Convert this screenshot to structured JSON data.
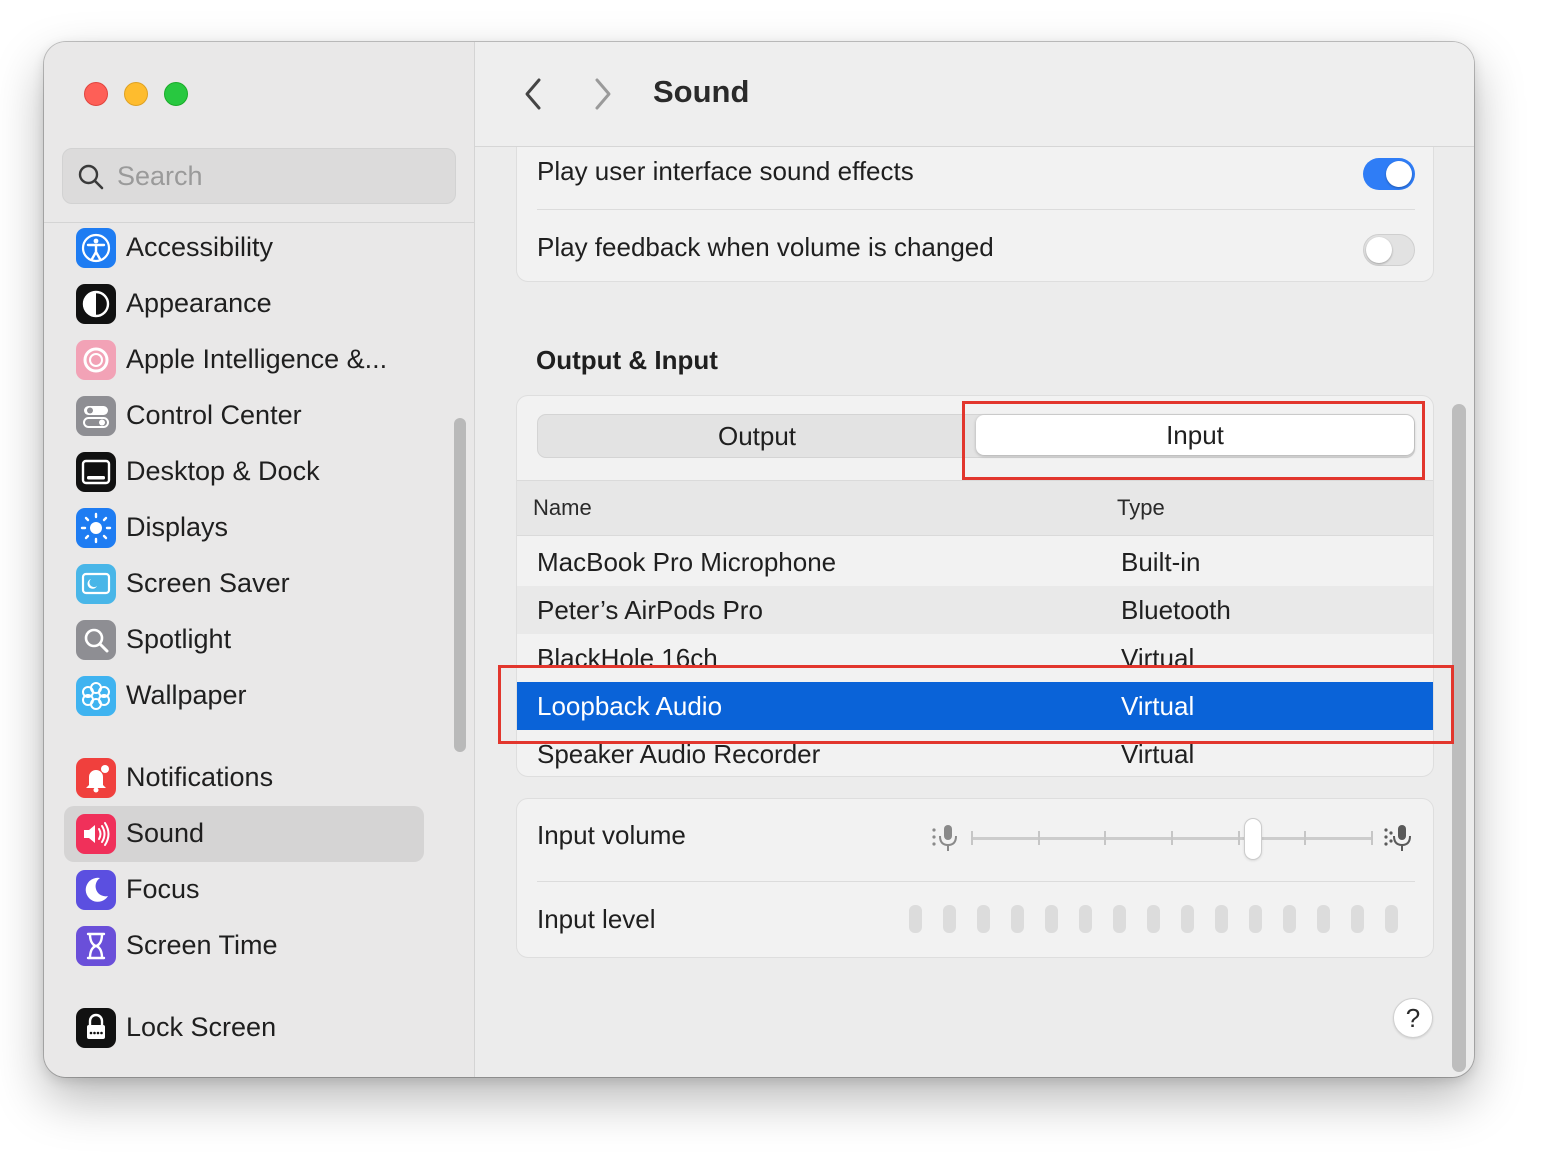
{
  "window": {
    "title": "Sound"
  },
  "sidebar": {
    "search_placeholder": "Search",
    "items": [
      {
        "label": "Accessibility",
        "icon": "accessibility-icon",
        "color": "#1e7cf2"
      },
      {
        "label": "Appearance",
        "icon": "appearance-icon",
        "color": "#111111"
      },
      {
        "label": "Apple Intelligence &...",
        "icon": "apple-intelligence-icon",
        "color": "#f2a2b6"
      },
      {
        "label": "Control Center",
        "icon": "control-center-icon",
        "color": "#8e8e93"
      },
      {
        "label": "Desktop & Dock",
        "icon": "desktop-dock-icon",
        "color": "#111111"
      },
      {
        "label": "Displays",
        "icon": "displays-icon",
        "color": "#1e7cf2"
      },
      {
        "label": "Screen Saver",
        "icon": "screen-saver-icon",
        "color": "#49b6e8"
      },
      {
        "label": "Spotlight",
        "icon": "spotlight-icon",
        "color": "#8e8e93"
      },
      {
        "label": "Wallpaper",
        "icon": "wallpaper-icon",
        "color": "#3fb3f0"
      },
      {
        "label": "Notifications",
        "icon": "notifications-icon",
        "color": "#f0403d"
      },
      {
        "label": "Sound",
        "icon": "sound-icon",
        "color": "#f0305a",
        "selected": true
      },
      {
        "label": "Focus",
        "icon": "focus-icon",
        "color": "#5b4fe0"
      },
      {
        "label": "Screen Time",
        "icon": "screen-time-icon",
        "color": "#6a4fd9"
      },
      {
        "label": "Lock Screen",
        "icon": "lock-screen-icon",
        "color": "#111111"
      }
    ]
  },
  "sound_effects": {
    "ui_sounds_label": "Play user interface sound effects",
    "ui_sounds_on": true,
    "feedback_label": "Play feedback when volume is changed",
    "feedback_on": false
  },
  "output_input": {
    "heading": "Output & Input",
    "tabs": [
      {
        "label": "Output",
        "selected": false
      },
      {
        "label": "Input",
        "selected": true
      }
    ],
    "columns": {
      "name": "Name",
      "type": "Type"
    },
    "devices": [
      {
        "name": "MacBook Pro Microphone",
        "type": "Built-in"
      },
      {
        "name": "Peter’s AirPods Pro",
        "type": "Bluetooth"
      },
      {
        "name": "BlackHole 16ch",
        "type": "Virtual"
      },
      {
        "name": "Loopback Audio",
        "type": "Virtual",
        "selected": true
      },
      {
        "name": "Speaker Audio Recorder",
        "type": "Virtual"
      }
    ]
  },
  "input_controls": {
    "volume_label": "Input volume",
    "volume_level": 0.71,
    "level_label": "Input level",
    "level_segments_lit": 0,
    "level_segments_total": 15
  },
  "help": {
    "label": "?"
  },
  "colors": {
    "accent": "#2f7df6",
    "selection": "#0a63d8",
    "annotation": "#e2362d"
  }
}
